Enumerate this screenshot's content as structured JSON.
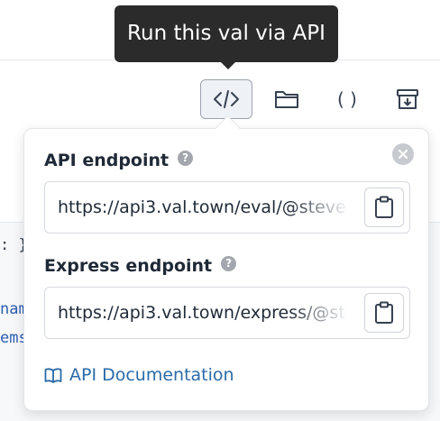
{
  "tooltip": {
    "text": "Run this val via API"
  },
  "toolbar": {
    "buttons": [
      {
        "name": "api-button",
        "icon": "code-icon"
      },
      {
        "name": "folder-button",
        "icon": "folder-icon"
      },
      {
        "name": "parens-button",
        "icon": "parentheses-icon",
        "label": "( )"
      },
      {
        "name": "archive-button",
        "icon": "archive-icon"
      }
    ]
  },
  "background_code": {
    "line1": ": }",
    "line2": "nam",
    "line3": "ems"
  },
  "popover": {
    "api": {
      "label": "API endpoint",
      "help": "?",
      "value": "https://api3.val.town/eval/@steve"
    },
    "express": {
      "label": "Express endpoint",
      "help": "?",
      "value": "https://api3.val.town/express/@st"
    },
    "docs_link": "API Documentation"
  },
  "colors": {
    "accent_link": "#2a6aa8",
    "tooltip_bg": "#2b2b2b"
  }
}
